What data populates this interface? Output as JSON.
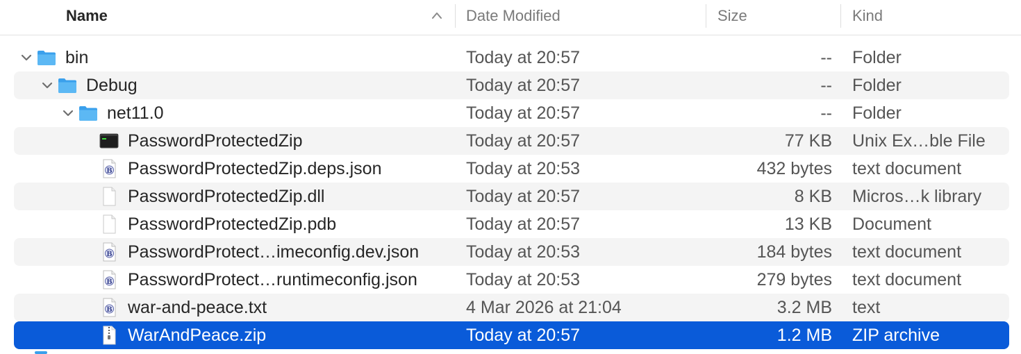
{
  "columns": {
    "name": "Name",
    "date": "Date Modified",
    "size": "Size",
    "kind": "Kind"
  },
  "sort": {
    "column": "name",
    "direction": "ascending",
    "icon": "chevron-up-icon"
  },
  "colors": {
    "selection": "#0a5bd9",
    "folder": "#3aa0ec",
    "alt_row": "#f4f4f4"
  },
  "rows": [
    {
      "name": "bin",
      "date": "Today at 20:57",
      "size": "--",
      "kind": "Folder",
      "icon": "folder-icon",
      "expanded": true
    },
    {
      "name": "Debug",
      "date": "Today at 20:57",
      "size": "--",
      "kind": "Folder",
      "icon": "folder-icon",
      "expanded": true
    },
    {
      "name": "net11.0",
      "date": "Today at 20:57",
      "size": "--",
      "kind": "Folder",
      "icon": "folder-icon",
      "expanded": true
    },
    {
      "name": "PasswordProtectedZip",
      "date": "Today at 20:57",
      "size": "77 KB",
      "kind": "Unix Ex…ble File",
      "icon": "terminal-executable-icon"
    },
    {
      "name": "PasswordProtectedZip.deps.json",
      "date": "Today at 20:53",
      "size": "432 bytes",
      "kind": "text document",
      "icon": "text-document-icon"
    },
    {
      "name": "PasswordProtectedZip.dll",
      "date": "Today at 20:57",
      "size": "8 KB",
      "kind": "Micros…k library",
      "icon": "blank-document-icon"
    },
    {
      "name": "PasswordProtectedZip.pdb",
      "date": "Today at 20:57",
      "size": "13 KB",
      "kind": "Document",
      "icon": "blank-document-icon"
    },
    {
      "name": "PasswordProtect…imeconfig.dev.json",
      "date": "Today at 20:53",
      "size": "184 bytes",
      "kind": "text document",
      "icon": "text-document-icon"
    },
    {
      "name": "PasswordProtect…runtimeconfig.json",
      "date": "Today at 20:53",
      "size": "279 bytes",
      "kind": "text document",
      "icon": "text-document-icon"
    },
    {
      "name": "war-and-peace.txt",
      "date": "4 Mar 2026 at 21:04",
      "size": "3.2 MB",
      "kind": "text",
      "icon": "text-document-icon"
    },
    {
      "name": "WarAndPeace.zip",
      "date": "Today at 20:57",
      "size": "1.2 MB",
      "kind": "ZIP archive",
      "icon": "zip-archive-icon",
      "selected": true
    }
  ]
}
